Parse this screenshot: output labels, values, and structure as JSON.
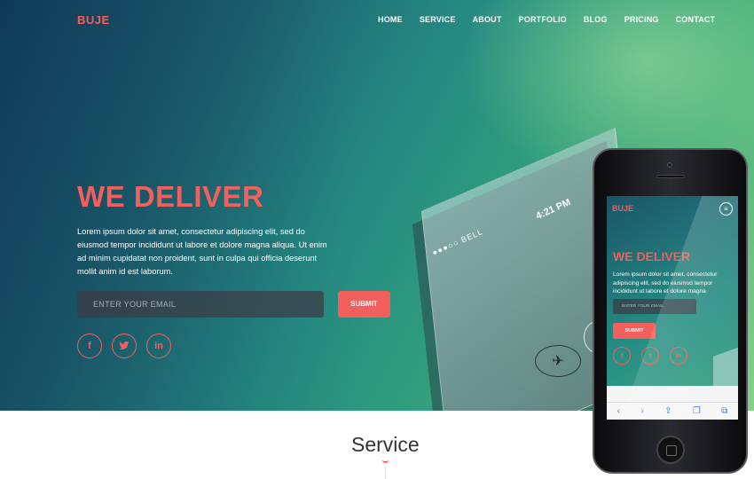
{
  "brand": {
    "logo": "BUJE",
    "accent_color": "#f25f5c"
  },
  "nav": {
    "items": [
      "HOME",
      "SERVICE",
      "ABOUT",
      "PORTFOLIO",
      "BLOG",
      "PRICING",
      "CONTACT"
    ]
  },
  "hero": {
    "headline": "WE DELIVER",
    "lead": "Lorem ipsum dolor sit amet, consectetur adipiscing elit, sed do eiusmod tempor incididunt ut labore et dolore magna aliqua. Ut enim ad minim cupidatat non proident, sunt in culpa qui officia deserunt mollit anim id est laborum.",
    "email_placeholder": "ENTER YOUR EMAIL",
    "submit_label": "SUBMIT",
    "socials": [
      {
        "icon": "facebook-icon",
        "glyph": "f"
      },
      {
        "icon": "twitter-icon",
        "glyph": "t"
      },
      {
        "icon": "linkedin-icon",
        "glyph": "in"
      }
    ]
  },
  "tilted_phone": {
    "carrier": "●●●○○ BELL",
    "time": "4:21 PM"
  },
  "phone_screen": {
    "logo": "BUJE",
    "headline": "WE DELIVER",
    "lead": "Lorem ipsum dolor sit amet, consectetur adipiscing elit, sed do eiusmod tempor incididunt ut labore et dolore magna",
    "email_placeholder": "ENTER YOUR EMAIL",
    "submit_label": "SUBMIT",
    "toolbar": [
      "‹",
      "›",
      "⇪",
      "❐",
      "⧉"
    ]
  },
  "section": {
    "title": "Service"
  }
}
